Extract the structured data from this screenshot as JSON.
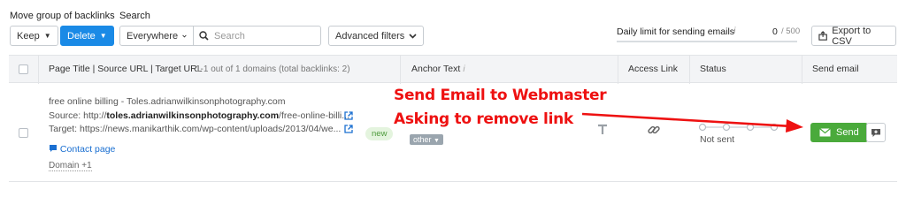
{
  "toolbar": {
    "move_group_label": "Move group of backlinks",
    "keep_label": "Keep",
    "delete_label": "Delete",
    "search_label": "Search",
    "scope_value": "Everywhere",
    "search_placeholder": "Search",
    "advanced_filters_label": "Advanced filters",
    "daily_limit_label": "Daily limit for sending emails",
    "daily_limit_value": "0",
    "daily_limit_max": "/ 500",
    "daily_limit_fraction": 0,
    "export_label": "Export to CSV"
  },
  "table": {
    "headers": {
      "page_title": "Page Title | Source URL | Target URL",
      "count": "1-1 out of 1 domains (total backlinks: 2)",
      "anchor": "Anchor Text",
      "access": "Access Link",
      "status": "Status",
      "send_email": "Send email"
    },
    "row": {
      "title": "free online billing - Toles.adrianwilkinsonphotography.com",
      "source_prefix": "Source: http://",
      "source_domain": "toles.adrianwilkinsonphotography.com",
      "source_rest": "/free-online-billi...",
      "target": "Target: https://news.manikarthik.com/wp-content/uploads/2013/04/we...",
      "contact_page": "Contact page",
      "domain_more": "Domain +1",
      "new_badge": "new",
      "other_badge": "other",
      "status": "Not sent",
      "send_label": "Send"
    }
  },
  "annotation": {
    "line1": "Send Email to Webmaster",
    "line2": "Asking to remove link",
    "color": "#ee1111"
  }
}
